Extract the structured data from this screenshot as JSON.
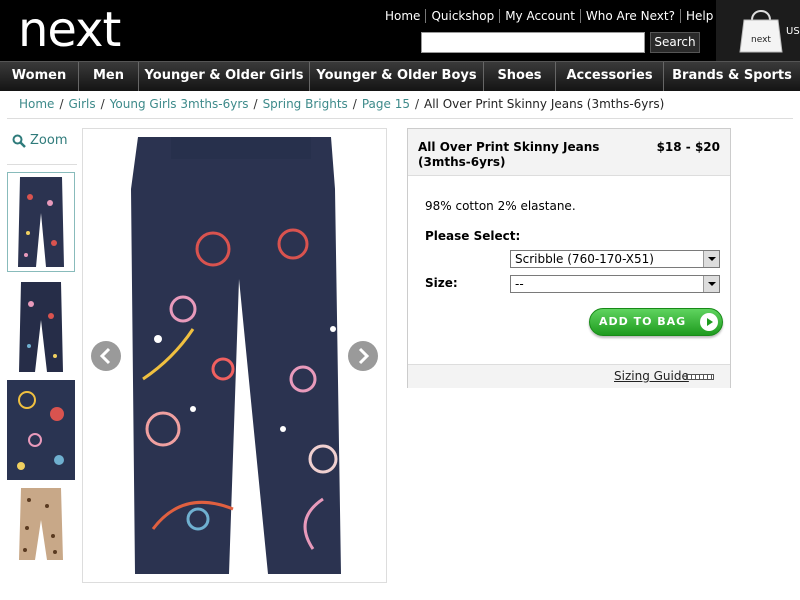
{
  "header": {
    "logo": "next",
    "links": [
      "Home",
      "Quickshop",
      "My Account",
      "Who Are Next?",
      "Help"
    ],
    "search_placeholder": "",
    "search_button": "Search",
    "bag_logo_text": "next",
    "region": "US"
  },
  "nav": {
    "items": [
      "Women",
      "Men",
      "Younger & Older Girls",
      "Younger & Older Boys",
      "Shoes",
      "Accessories",
      "Brands & Sports"
    ]
  },
  "breadcrumb": {
    "links": [
      "Home",
      "Girls",
      "Young Girls 3mths-6yrs",
      "Spring Brights",
      "Page 15"
    ],
    "current": "All Over Print Skinny Jeans (3mths-6yrs)"
  },
  "gallery": {
    "zoom_label": "Zoom",
    "thumb_count": 4
  },
  "product": {
    "title": "All Over Print Skinny Jeans (3mths-6yrs)",
    "price": "$18 - $20",
    "description": "98% cotton 2% elastane.",
    "select_label": "Please Select:",
    "style_value": "Scribble (760-170-X51)",
    "size_label": "Size:",
    "size_value": "--",
    "add_to_bag": "ADD TO BAG",
    "sizing_guide": "Sizing Guide"
  },
  "colors": {
    "header_bg": "#000000",
    "link_teal": "#3d8a8a",
    "button_green": "#2aae2a",
    "jeans_navy": "#2b3350"
  }
}
